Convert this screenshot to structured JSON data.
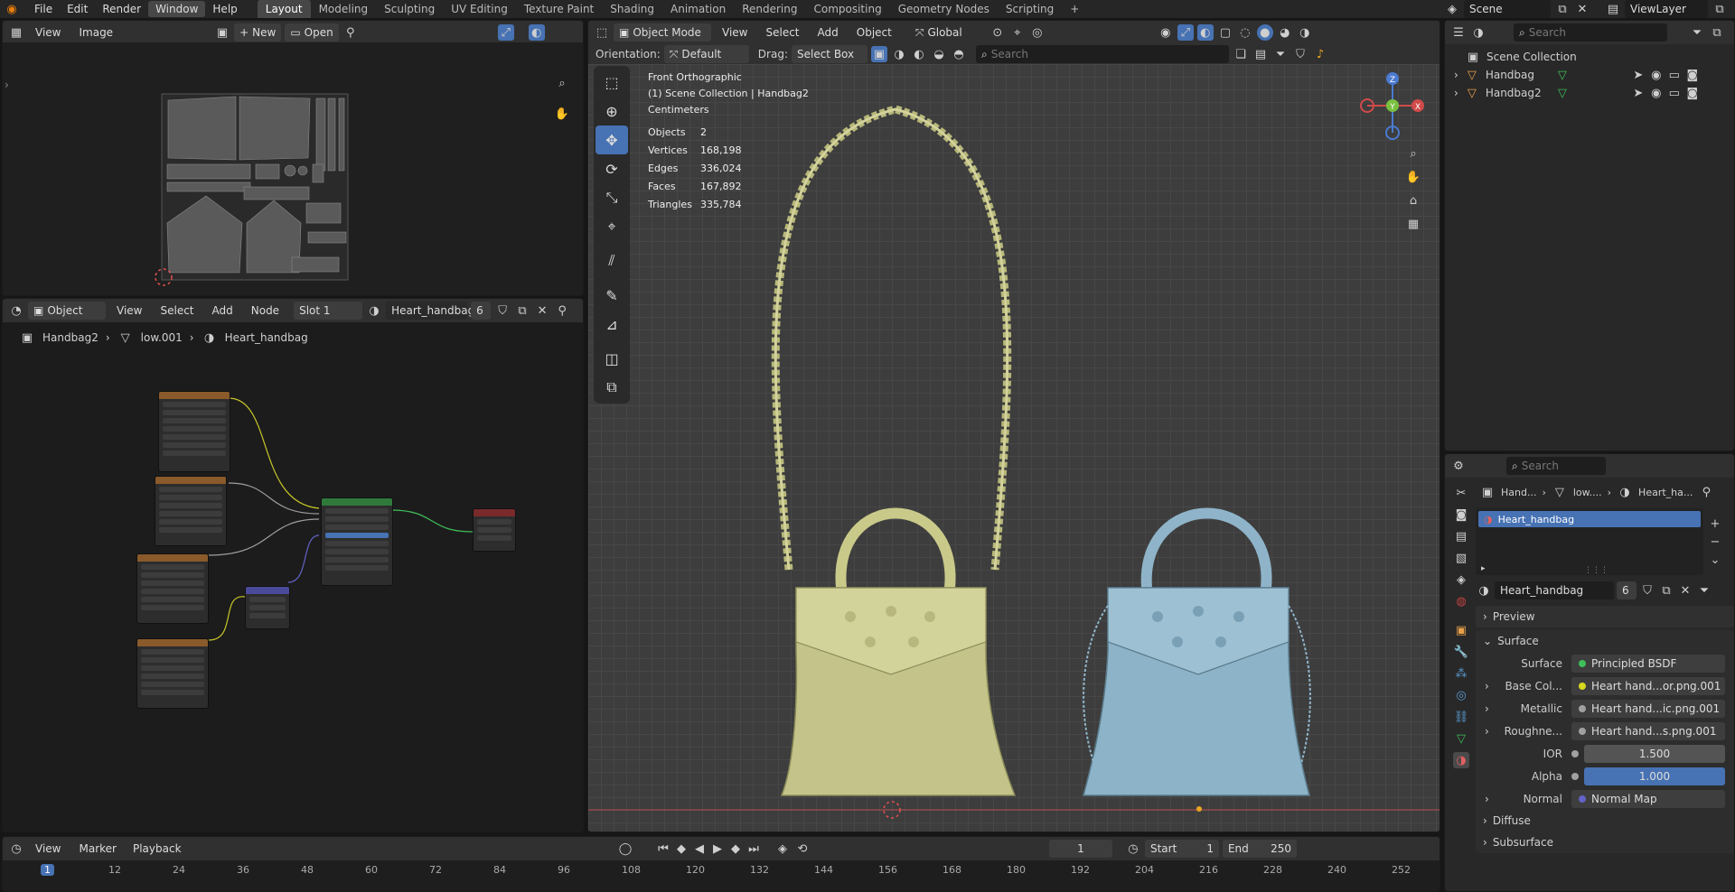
{
  "topbar": {
    "menus": [
      "File",
      "Edit",
      "Render",
      "Window",
      "Help"
    ],
    "active_menu": "Window",
    "workspaces": [
      "Layout",
      "Modeling",
      "Sculpting",
      "UV Editing",
      "Texture Paint",
      "Shading",
      "Animation",
      "Rendering",
      "Compositing",
      "Geometry Nodes",
      "Scripting"
    ],
    "active_workspace": "Layout",
    "add_tab": "+",
    "scene": "Scene",
    "view_layer": "ViewLayer"
  },
  "uv_editor": {
    "menus": [
      "View",
      "Image"
    ],
    "new_label": "New",
    "open_label": "Open"
  },
  "node_editor": {
    "mode": "Object",
    "menus": [
      "View",
      "Select",
      "Add",
      "Node"
    ],
    "slot": "Slot 1",
    "material": "Heart_handbag",
    "users": "6",
    "breadcrumb": [
      "Handbag2",
      "low.001",
      "Heart_handbag"
    ]
  },
  "viewport": {
    "mode": "Object Mode",
    "menus": [
      "View",
      "Select",
      "Add",
      "Object"
    ],
    "orientation_label": "Global",
    "orientation_row_label": "Orientation:",
    "orientation_value": "Default",
    "drag_label": "Drag:",
    "drag_value": "Select Box",
    "search_placeholder": "Search",
    "overlay_title": "Front Orthographic",
    "overlay_collection": "(1) Scene Collection | Handbag2",
    "overlay_units": "Centimeters",
    "stats": [
      {
        "label": "Objects",
        "value": "2"
      },
      {
        "label": "Vertices",
        "value": "168,198"
      },
      {
        "label": "Edges",
        "value": "336,024"
      },
      {
        "label": "Faces",
        "value": "167,892"
      },
      {
        "label": "Triangles",
        "value": "335,784"
      }
    ],
    "gizmo": {
      "z": "Z",
      "y": "Y",
      "x": "X"
    },
    "colors": {
      "bag1": "#c9c98a",
      "bag2": "#8fb4c9",
      "active_tool": "#4772b3"
    }
  },
  "outliner": {
    "search_placeholder": "Search",
    "root": "Scene Collection",
    "items": [
      "Handbag",
      "Handbag2"
    ]
  },
  "properties": {
    "search_placeholder": "Search",
    "breadcrumb": [
      "Hand...",
      "low....",
      "Heart_ha..."
    ],
    "slot_item": "Heart_handbag",
    "material": "Heart_handbag",
    "users": "6",
    "sections": {
      "preview": "Preview",
      "surface": "Surface",
      "diffuse": "Diffuse",
      "subsurface": "Subsurface"
    },
    "rows": [
      {
        "label": "Surface",
        "value": "Principled BSDF",
        "dot": "#3fbf5a"
      },
      {
        "label": "Base Col...",
        "value": "Heart hand...or.png.001",
        "dot": "#d8d81e"
      },
      {
        "label": "Metallic",
        "value": "Heart hand...ic.png.001",
        "dot": "#a0a0a0"
      },
      {
        "label": "Roughne...",
        "value": "Heart hand...s.png.001",
        "dot": "#a0a0a0"
      },
      {
        "label": "IOR",
        "value": "1.500"
      },
      {
        "label": "Alpha",
        "value": "1.000"
      },
      {
        "label": "Normal",
        "value": "Normal Map",
        "dot": "#6363c7"
      }
    ]
  },
  "timeline": {
    "menus": [
      "View",
      "Marker",
      "Playback"
    ],
    "current_frame": "1",
    "start_label": "Start",
    "start": "1",
    "end_label": "End",
    "end": "250",
    "ticks": [
      "1",
      "12",
      "24",
      "36",
      "48",
      "60",
      "72",
      "84",
      "96",
      "108",
      "120",
      "132",
      "144",
      "156",
      "168",
      "180",
      "192",
      "204",
      "216",
      "228",
      "240",
      "252"
    ]
  }
}
